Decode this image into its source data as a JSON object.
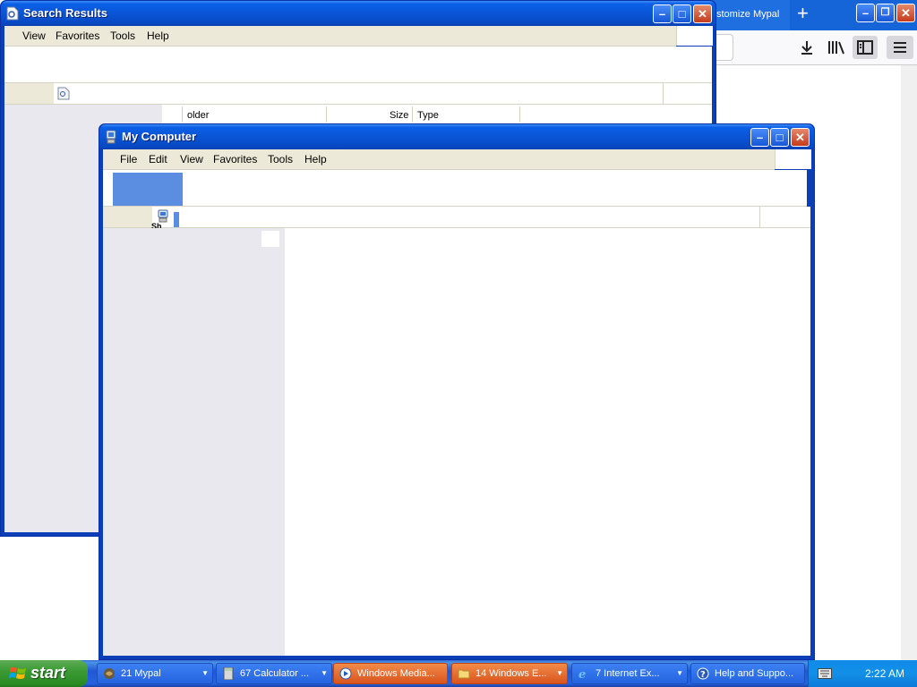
{
  "firefox": {
    "tab_title": "stomize Mypal",
    "new_tab": "+"
  },
  "search_window": {
    "title": "Search Results",
    "menu": [
      "View",
      "Favorites",
      "Tools",
      "Help"
    ],
    "columns": [
      "older",
      "Size",
      "Type"
    ]
  },
  "mycomputer_window": {
    "title": "My Computer",
    "menu": [
      "File",
      "Edit",
      "View",
      "Favorites",
      "Tools",
      "Help"
    ],
    "icon_caption": "Sh"
  },
  "taskbar": {
    "start_label": "start",
    "tasks": [
      {
        "label": "21 Mypal",
        "icon": "mypal-icon",
        "active": false
      },
      {
        "label": "67 Calculator ...",
        "icon": "calculator-icon",
        "active": false
      },
      {
        "label": "Windows Media...",
        "icon": "media-player-icon",
        "active": true
      },
      {
        "label": "14 Windows E...",
        "icon": "folder-icon",
        "active": true
      },
      {
        "label": "7 Internet Ex...",
        "icon": "internet-explorer-icon",
        "active": false
      },
      {
        "label": "Help and Suppo...",
        "icon": "help-icon",
        "active": false
      }
    ],
    "clock": "2:22 AM"
  },
  "colors": {
    "xp_blue": "#0a55d6",
    "taskbar_blue": "#2663e0",
    "start_green": "#3c9a35",
    "active_task_orange": "#e06a2e",
    "menu_bg": "#ece9d8",
    "pane_gray": "#e9e8ee"
  }
}
